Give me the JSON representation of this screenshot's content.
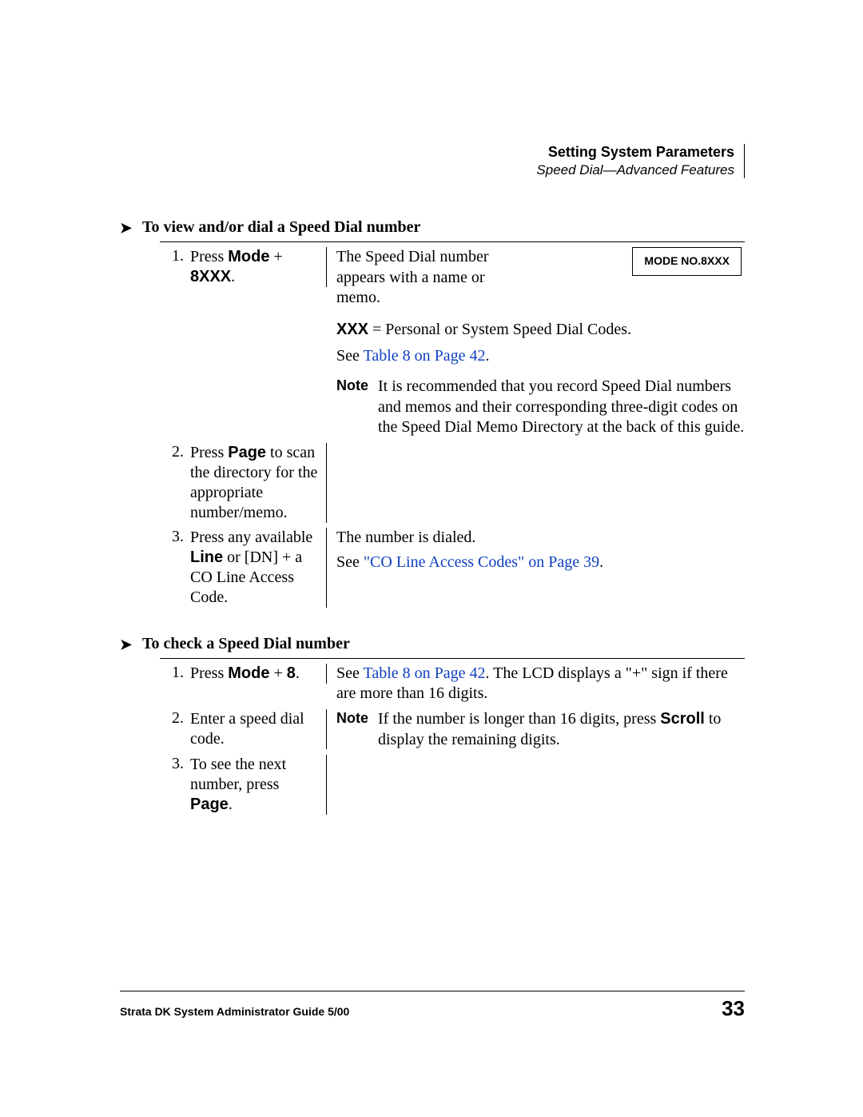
{
  "header": {
    "title": "Setting System Parameters",
    "subtitle": "Speed Dial—Advanced Features"
  },
  "sections": [
    {
      "title": "To view and/or dial a Speed Dial number",
      "rows": [
        {
          "num": "1.",
          "left_pre": "Press ",
          "left_b1": "Mode",
          "left_mid": " + ",
          "left_b2": "8XXX",
          "left_post": ".",
          "r_para1": "The Speed Dial number appears with a name or memo.",
          "lcd": "MODE NO.8XXX",
          "xxx_b": "XXX",
          "xxx_rest": " = Personal or System Speed Dial Codes.",
          "see_pre": "See ",
          "see_link": "Table 8 on Page 42",
          "see_post": ".",
          "note_lbl": "Note",
          "note_body": "It is recommended that you record Speed Dial numbers and memos and their corresponding three-digit codes on the Speed Dial Memo Directory at the back of this guide."
        },
        {
          "num": "2.",
          "left_pre": "Press ",
          "left_b1": "Page",
          "left_post": " to scan the directory for the appropriate number/memo."
        },
        {
          "num": "3.",
          "left_plain1": "Press any available ",
          "left_b1": "Line",
          "left_plain2": " or [DN] + a CO Line Access Code.",
          "r_line1": "The number is dialed.",
          "see_pre": "See ",
          "see_link": "\"CO Line Access Codes\" on Page 39",
          "see_post": "."
        }
      ]
    },
    {
      "title": "To check a Speed Dial number",
      "rows": [
        {
          "num": "1.",
          "left_pre": "Press ",
          "left_b1": "Mode",
          "left_mid": " + ",
          "left_b2": "8",
          "left_post": ".",
          "see_pre": "See ",
          "see_link": "Table 8 on Page 42",
          "r_tail": ". The LCD displays a \"+\" sign if there are more than 16 digits."
        },
        {
          "num": "2.",
          "left_plain1": "Enter a speed dial code.",
          "note_lbl": "Note",
          "note_pre": "If the number is longer than 16 digits, press ",
          "note_b": "Scroll",
          "note_post": " to display the remaining digits."
        },
        {
          "num": "3.",
          "left_plain1": "To see the next number, press ",
          "left_b1": "Page",
          "left_post": "."
        }
      ]
    }
  ],
  "footer": {
    "left": "Strata DK System Administrator Guide   5/00",
    "page": "33"
  }
}
